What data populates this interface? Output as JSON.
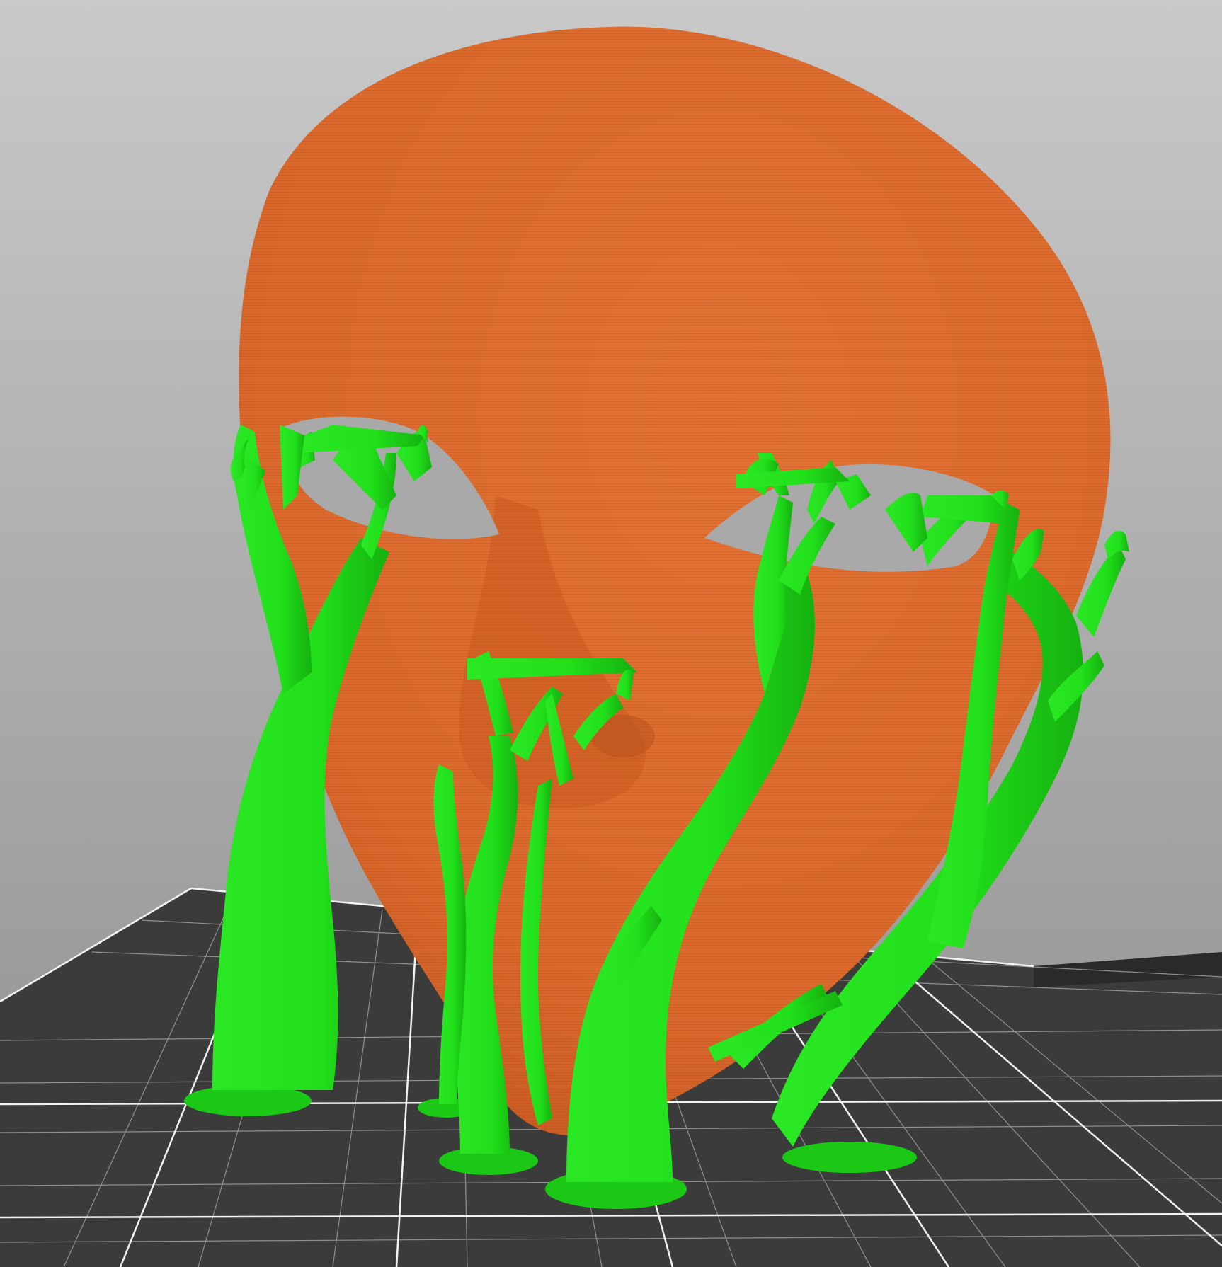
{
  "scene": {
    "background_top": "#c9c9c9",
    "background_bottom": "#8f8f8f",
    "bed_color": "#3b3b3b",
    "bed_dark": "#2a2a2a",
    "grid_line_color": "#9a9a9a",
    "grid_bold_color": "#f2f2f2"
  },
  "model": {
    "name": "face-mask",
    "color": "#d9692d",
    "shade_color": "#c4561f"
  },
  "supports": {
    "type": "tree",
    "color": "#21e01b",
    "shade_color": "#17b412"
  }
}
